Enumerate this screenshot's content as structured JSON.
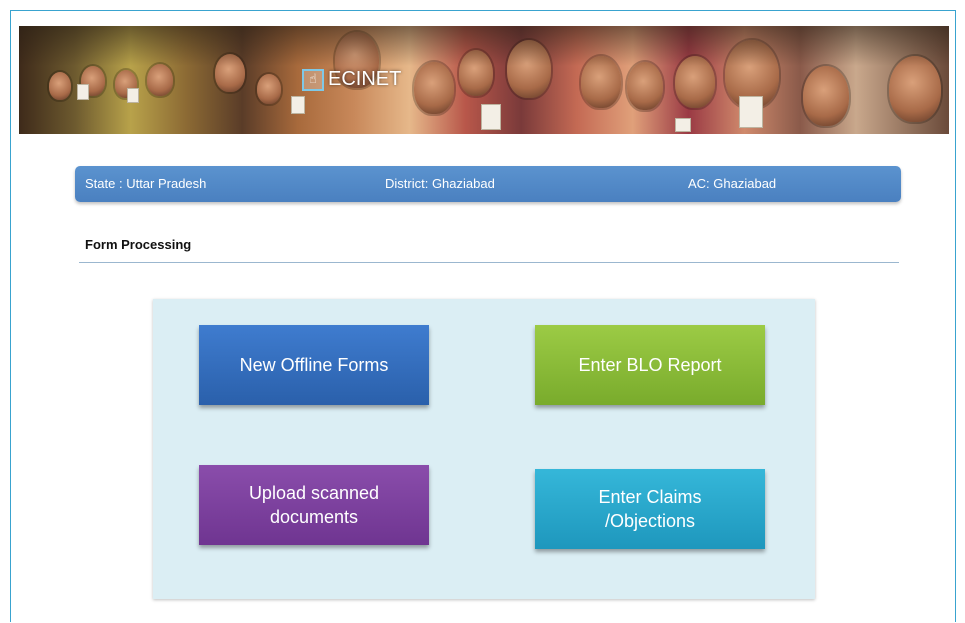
{
  "header": {
    "logo_text": "ECINET",
    "logo_icon": "hand-icon"
  },
  "info_bar": {
    "state": "State : Uttar Pradesh",
    "district": "District:  Ghaziabad",
    "ac": "AC:  Ghaziabad"
  },
  "section": {
    "title": "Form Processing"
  },
  "actions": {
    "new_offline_forms": "New Offline Forms",
    "enter_blo_report": "Enter BLO Report",
    "upload_scanned_documents": "Upload scanned\ndocuments",
    "enter_claims_objections": "Enter Claims\n/Objections"
  },
  "colors": {
    "frame_border": "#39a3cf",
    "info_bar": "#4a80c0",
    "panel": "#dbeef4",
    "tile_blue": "#2f6dbf",
    "tile_green": "#8cbd3a",
    "tile_purple": "#7b3f9e",
    "tile_cyan": "#29a9cf"
  }
}
